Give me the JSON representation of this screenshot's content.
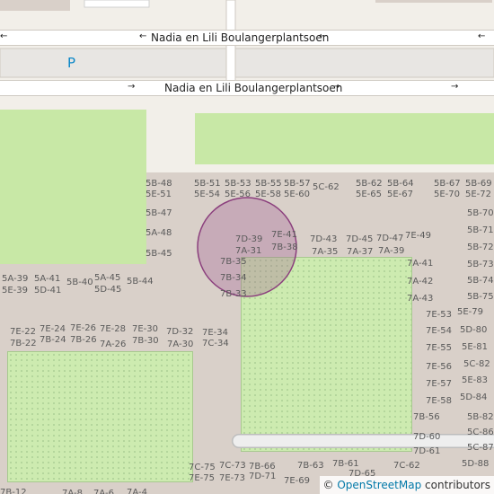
{
  "streets": {
    "upper_name": "Nadia en Lili Boulangerplantsoen",
    "lower_name": "Nadia en Lili Boulangerplantsoen",
    "upper_arrow": "←",
    "lower_arrow": "→"
  },
  "parking": {
    "label": "P",
    "color": "#0a87c8"
  },
  "colors": {
    "residential": "#d9d0c9",
    "park": "#c8e8a6",
    "road": "#ffffff",
    "marker": "#9b4d8c"
  },
  "attribution": {
    "prefix": "© ",
    "link": "OpenStreetMap",
    "suffix": " contributors"
  },
  "addresses": [
    "5B-48",
    "5E-51",
    "5B-51",
    "5E-54",
    "5B-53",
    "5E-56",
    "5B-55",
    "5E-58",
    "5B-57",
    "5E-60",
    "5C-62",
    "5B-62",
    "5E-65",
    "5B-64",
    "5E-67",
    "5B-67",
    "5E-70",
    "5B-69",
    "5E-72",
    "5B-47",
    "5A-48",
    "5B-45",
    "7D-39",
    "7A-31",
    "7E-41",
    "7B-38",
    "7B-35",
    "7B-34",
    "7B-33",
    "7D-43",
    "7A-35",
    "7D-45",
    "7A-37",
    "7D-47",
    "7A-39",
    "7E-49",
    "5B-70",
    "5B-71",
    "5B-72",
    "5B-73",
    "5B-74",
    "5B-75",
    "5E-79",
    "5D-80",
    "5E-81",
    "5C-82",
    "5E-83",
    "5D-84",
    "5B-82",
    "5C-86",
    "5C-87",
    "5D-88",
    "7A-41",
    "7A-42",
    "7A-43",
    "7E-53",
    "7E-54",
    "7E-55",
    "7E-56",
    "7E-57",
    "7E-58",
    "7B-56",
    "7D-60",
    "7D-61",
    "7C-62",
    "7D-65",
    "7B-61",
    "7B-63",
    "7E-69",
    "5A-39",
    "5E-39",
    "5A-41",
    "5D-41",
    "5B-40",
    "5A-45",
    "5D-45",
    "5B-44",
    "7E-22",
    "7B-22",
    "7E-24",
    "7B-24",
    "7E-26",
    "7B-26",
    "7E-28",
    "7A-26",
    "7E-30",
    "7B-30",
    "7D-32",
    "7A-30",
    "7E-34",
    "7C-34",
    "7C-75",
    "7E-75",
    "7C-73",
    "7E-73",
    "7B-66",
    "7D-71",
    "7B-12",
    "7A-8",
    "7A-6",
    "7A-4"
  ]
}
